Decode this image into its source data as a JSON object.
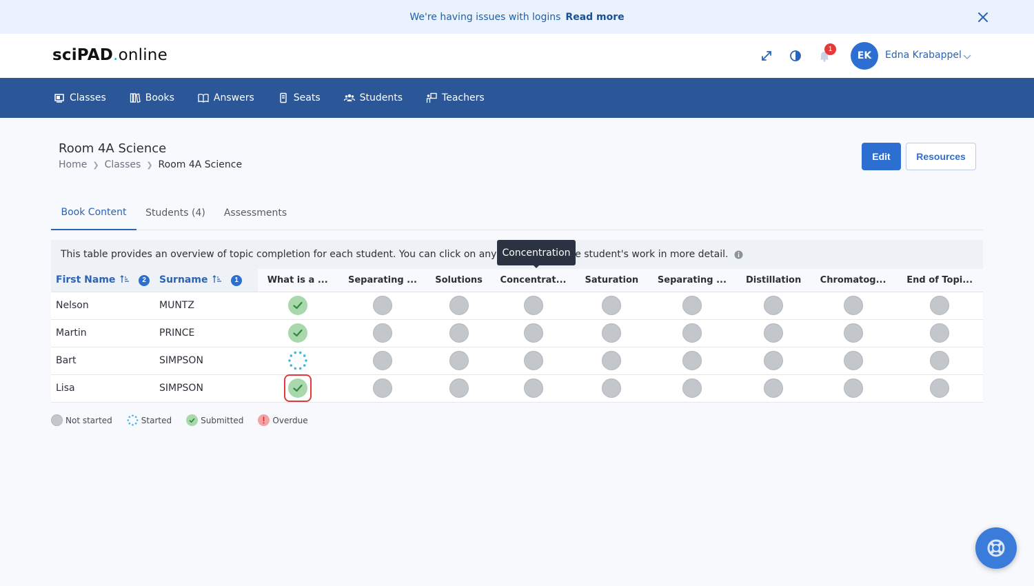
{
  "banner": {
    "message": "We're having issues with logins",
    "link": "Read more"
  },
  "header": {
    "logo_prefix": "sciPAD",
    "logo_dot": ".",
    "logo_suffix": "online",
    "notification_count": "1",
    "user_initials": "EK",
    "user_name": "Edna Krabappel"
  },
  "nav": [
    {
      "label": "Classes",
      "icon": "classes-icon"
    },
    {
      "label": "Books",
      "icon": "books-icon"
    },
    {
      "label": "Answers",
      "icon": "answers-icon"
    },
    {
      "label": "Seats",
      "icon": "seats-icon"
    },
    {
      "label": "Students",
      "icon": "students-icon"
    },
    {
      "label": "Teachers",
      "icon": "teachers-icon"
    }
  ],
  "page": {
    "title": "Room 4A Science",
    "breadcrumb": [
      "Home",
      "Classes",
      "Room 4A Science"
    ],
    "edit_label": "Edit",
    "resources_label": "Resources"
  },
  "tabs": [
    "Book Content",
    "Students (4)",
    "Assessments"
  ],
  "info_text": "This table provides an overview of topic completion for each student. You can click on any status to see the student's work in more detail.",
  "tooltip": "Concentration",
  "table": {
    "first_name_header": "First Name",
    "first_name_sort": "2",
    "surname_header": "Surname",
    "surname_sort": "1",
    "topics": [
      "What is a ...",
      "Separating ...",
      "Solutions",
      "Concentrat...",
      "Saturation",
      "Separating ...",
      "Distillation",
      "Chromatog...",
      "End of Topi..."
    ],
    "rows": [
      {
        "first": "Nelson",
        "surname": "MUNTZ",
        "status": [
          "submitted",
          "not-started",
          "not-started",
          "not-started",
          "not-started",
          "not-started",
          "not-started",
          "not-started",
          "not-started"
        ]
      },
      {
        "first": "Martin",
        "surname": "PRINCE",
        "status": [
          "submitted",
          "not-started",
          "not-started",
          "not-started",
          "not-started",
          "not-started",
          "not-started",
          "not-started",
          "not-started"
        ]
      },
      {
        "first": "Bart",
        "surname": "SIMPSON",
        "status": [
          "started",
          "not-started",
          "not-started",
          "not-started",
          "not-started",
          "not-started",
          "not-started",
          "not-started",
          "not-started"
        ]
      },
      {
        "first": "Lisa",
        "surname": "SIMPSON",
        "status": [
          "submitted",
          "not-started",
          "not-started",
          "not-started",
          "not-started",
          "not-started",
          "not-started",
          "not-started",
          "not-started"
        ]
      }
    ],
    "highlighted_cell": {
      "row": 3,
      "col": 0
    }
  },
  "legend": [
    {
      "label": "Not started",
      "status": "not-started"
    },
    {
      "label": "Started",
      "status": "started"
    },
    {
      "label": "Submitted",
      "status": "submitted"
    },
    {
      "label": "Overdue",
      "status": "overdue"
    }
  ],
  "colors": {
    "nav_bg": "#2b5798",
    "accent": "#2c6fd1",
    "submitted": "#a8d8ac",
    "not_started": "#c3c6cb",
    "started": "#3fb6e0",
    "overdue": "#f2a3a6",
    "highlight": "#e0393d"
  }
}
